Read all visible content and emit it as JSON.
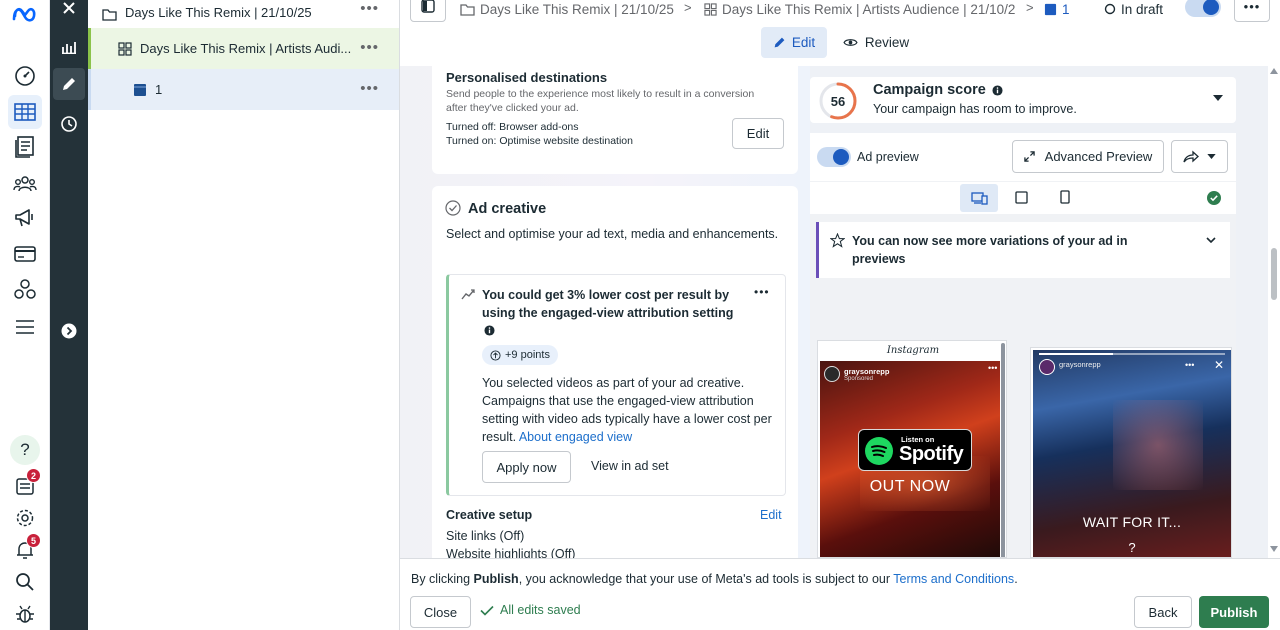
{
  "nav": {
    "help_badge_label": "?",
    "notifications_badge": "2",
    "alerts_badge": "5"
  },
  "tree": {
    "campaign": "Days Like This Remix | 21/10/25",
    "adset": "Days Like This Remix | Artists Audi...",
    "ad": "1"
  },
  "topbar": {
    "crumb_campaign": "Days Like This Remix | 21/10/25",
    "crumb_adset": "Days Like This Remix | Artists Audience | 21/10/2",
    "crumb_ad": "1",
    "status": "In draft",
    "edit_tab": "Edit",
    "review_tab": "Review"
  },
  "destinations": {
    "title": "Personalised destinations",
    "desc": "Send people to the experience most likely to result in a conversion after they've clicked your ad.",
    "turned_off_label": "Turned off:",
    "turned_off_value": "Browser add-ons",
    "turned_on_label": "Turned on:",
    "turned_on_value": "Optimise website destination",
    "edit": "Edit"
  },
  "creative": {
    "title": "Ad creative",
    "desc": "Select and optimise your ad text, media and enhancements.",
    "tip_title": "You could get 3% lower cost per result by using the engaged-view attribution setting",
    "points": "+9 points",
    "tip_body": "You selected videos as part of your ad creative. Campaigns that use the engaged-view attribution setting with video ads typically have a lower cost per result.",
    "tip_link": "About engaged view",
    "apply": "Apply now",
    "view": "View in ad set",
    "setup_title": "Creative setup",
    "setup_edit": "Edit",
    "setup_item1": "Site links (Off)",
    "setup_item2": "Website highlights (Off)"
  },
  "score": {
    "value": 56,
    "title": "Campaign score",
    "subtitle": "Your campaign has room to improve."
  },
  "preview": {
    "toggle_label": "Ad preview",
    "advanced": "Advanced Preview",
    "banner": "You can now see more variations of your ad in previews",
    "insta_label": "Instagram",
    "account1": "graysonrepp",
    "sponsored": "Sponsored",
    "spotify_small": "Listen on",
    "spotify_big": "Spotify",
    "out_now": "OUT NOW",
    "account2": "graysonrepp",
    "wait_text": "WAIT FOR IT...",
    "question": "?"
  },
  "footer": {
    "consent_pre": "By clicking ",
    "consent_bold": "Publish",
    "consent_post": ", you acknowledge that your use of Meta's ad tools is subject to our ",
    "terms": "Terms and Conditions",
    "period": ".",
    "close": "Close",
    "saved": "All edits saved",
    "back": "Back",
    "publish": "Publish"
  },
  "colors": {
    "accent": "#1d6fcb",
    "publish_green": "#2e7d4f",
    "score_ring": "#e8744b",
    "dark_panel": "#243239"
  }
}
